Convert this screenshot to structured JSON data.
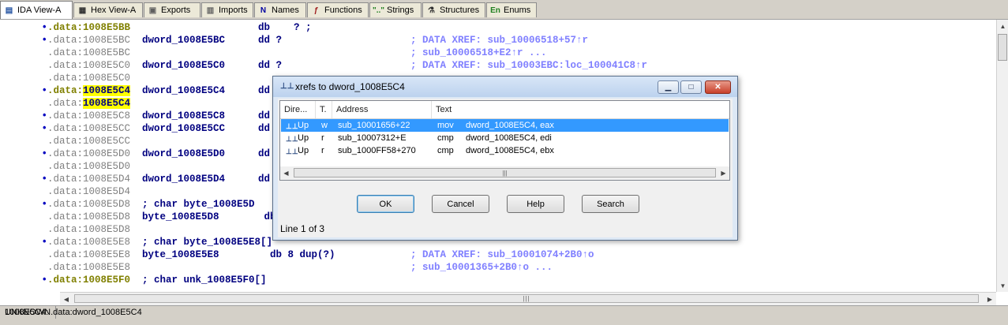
{
  "tabs": [
    {
      "label": "IDA View-A",
      "icon": "ida-view-icon",
      "glyph": "▤",
      "color": "#2050a0",
      "active": true
    },
    {
      "label": "Hex View-A",
      "icon": "hex-view-icon",
      "glyph": "▦",
      "color": "#303030",
      "active": false
    },
    {
      "label": "Exports",
      "icon": "exports-icon",
      "glyph": "▣",
      "color": "#606060",
      "active": false
    },
    {
      "label": "Imports",
      "icon": "imports-icon",
      "glyph": "▥",
      "color": "#606060",
      "active": false
    },
    {
      "label": "Names",
      "icon": "names-icon",
      "glyph": "N",
      "color": "#0000a0",
      "active": false
    },
    {
      "label": "Functions",
      "icon": "functions-icon",
      "glyph": "ƒ",
      "color": "#a02020",
      "active": false
    },
    {
      "label": "Strings",
      "icon": "strings-icon",
      "glyph": "\"..\"",
      "color": "#208020",
      "active": false
    },
    {
      "label": "Structures",
      "icon": "structures-icon",
      "glyph": "⚗",
      "color": "#303030",
      "active": false
    },
    {
      "label": "Enums",
      "icon": "enums-icon",
      "glyph": "En",
      "color": "#208020",
      "active": false
    }
  ],
  "listing": [
    {
      "bullet": "•",
      "addr_prefix": ".data:",
      "addr": "1008E5BB",
      "highlight": false,
      "dim": false,
      "name": "",
      "op": "db    ? ;",
      "comment": ""
    },
    {
      "bullet": "•",
      "addr_prefix": ".data:",
      "addr": "1008E5BC",
      "highlight": false,
      "dim": true,
      "name": "dword_1008E5BC",
      "op": "dd ?",
      "comment": "; DATA XREF: sub_10006518+57↑r"
    },
    {
      "bullet": "",
      "addr_prefix": ".data:",
      "addr": "1008E5BC",
      "highlight": false,
      "dim": true,
      "name": "",
      "op": "",
      "comment": "; sub_10006518+E2↑r ..."
    },
    {
      "bullet": "",
      "addr_prefix": ".data:",
      "addr": "1008E5C0",
      "highlight": false,
      "dim": true,
      "name": "dword_1008E5C0",
      "op": "dd ?",
      "comment": "; DATA XREF: sub_10003EBC:loc_100041C8↑r"
    },
    {
      "bullet": "",
      "addr_prefix": ".data:",
      "addr": "1008E5C0",
      "highlight": false,
      "dim": true,
      "name": "",
      "op": "",
      "comment": ""
    },
    {
      "bullet": "•",
      "addr_prefix": ".data:",
      "addr": "1008E5C4",
      "highlight": true,
      "dim": false,
      "name": "dword_1008E5C4",
      "op": "dd",
      "comment": ""
    },
    {
      "bullet": "",
      "addr_prefix": ".data:",
      "addr": "1008E5C4",
      "highlight": true,
      "dim": true,
      "name": "",
      "op": "",
      "comment": ""
    },
    {
      "bullet": "•",
      "addr_prefix": ".data:",
      "addr": "1008E5C8",
      "highlight": false,
      "dim": true,
      "name": "dword_1008E5C8",
      "op": "dd",
      "comment": ""
    },
    {
      "bullet": "•",
      "addr_prefix": ".data:",
      "addr": "1008E5CC",
      "highlight": false,
      "dim": true,
      "name": "dword_1008E5CC",
      "op": "dd",
      "comment": ""
    },
    {
      "bullet": "",
      "addr_prefix": ".data:",
      "addr": "1008E5CC",
      "highlight": false,
      "dim": true,
      "name": "",
      "op": "",
      "comment": ""
    },
    {
      "bullet": "•",
      "addr_prefix": ".data:",
      "addr": "1008E5D0",
      "highlight": false,
      "dim": true,
      "name": "dword_1008E5D0",
      "op": "dd",
      "comment": ""
    },
    {
      "bullet": "",
      "addr_prefix": ".data:",
      "addr": "1008E5D0",
      "highlight": false,
      "dim": true,
      "name": "",
      "op": "",
      "comment": ""
    },
    {
      "bullet": "•",
      "addr_prefix": ".data:",
      "addr": "1008E5D4",
      "highlight": false,
      "dim": true,
      "name": "dword_1008E5D4",
      "op": "dd",
      "comment": ""
    },
    {
      "bullet": "",
      "addr_prefix": ".data:",
      "addr": "1008E5D4",
      "highlight": false,
      "dim": true,
      "name": "",
      "op": "",
      "comment": ""
    },
    {
      "bullet": "•",
      "addr_prefix": ".data:",
      "addr": "1008E5D8",
      "highlight": false,
      "dim": true,
      "name": "; char byte_1008E5D",
      "op": "",
      "comment": ""
    },
    {
      "bullet": "",
      "addr_prefix": ".data:",
      "addr": "1008E5D8",
      "highlight": false,
      "dim": true,
      "name": "byte_1008E5D8",
      "op": " db",
      "comment": ""
    },
    {
      "bullet": "",
      "addr_prefix": ".data:",
      "addr": "1008E5D8",
      "highlight": false,
      "dim": true,
      "name": "",
      "op": "",
      "comment": ""
    },
    {
      "bullet": "•",
      "addr_prefix": ".data:",
      "addr": "1008E5E8",
      "highlight": false,
      "dim": true,
      "name": "; char byte_1008E5E8[]",
      "op": "",
      "comment": ""
    },
    {
      "bullet": "",
      "addr_prefix": ".data:",
      "addr": "1008E5E8",
      "highlight": false,
      "dim": true,
      "name": "byte_1008E5E8",
      "op": "  db 8 dup(?)",
      "comment": "; DATA XREF: sub_10001074+2B0↑o"
    },
    {
      "bullet": "",
      "addr_prefix": ".data:",
      "addr": "1008E5E8",
      "highlight": false,
      "dim": true,
      "name": "",
      "op": "",
      "comment": "; sub_10001365+2B0↑o ..."
    },
    {
      "bullet": "•",
      "addr_prefix": ".data:",
      "addr": "1008E5F0",
      "highlight": false,
      "dim": false,
      "name": "; char unk_1008E5F0[]",
      "op": "",
      "comment": ""
    }
  ],
  "status": {
    "mode": "UNKNOWN",
    "location": "1008E5C4: .data:dword_1008E5C4"
  },
  "dialog": {
    "title": "xrefs to dword_1008E5C4",
    "columns": [
      "Dire...",
      "T.",
      "Address",
      "Text"
    ],
    "rows": [
      {
        "direction": "Up",
        "type": "w",
        "address": "sub_10001656+22",
        "text_mnem": "mov",
        "text_ops": "dword_1008E5C4, eax",
        "selected": true
      },
      {
        "direction": "Up",
        "type": "r",
        "address": "sub_10007312+E",
        "text_mnem": "cmp",
        "text_ops": "dword_1008E5C4, edi",
        "selected": false
      },
      {
        "direction": "Up",
        "type": "r",
        "address": "sub_1000FF58+270",
        "text_mnem": "cmp",
        "text_ops": "dword_1008E5C4, ebx",
        "selected": false
      }
    ],
    "buttons": {
      "ok": "OK",
      "cancel": "Cancel",
      "help": "Help",
      "search": "Search"
    },
    "status_line": "Line 1 of 3"
  },
  "colors": {
    "selection": "#3399ff",
    "highlight": "#ffff00",
    "comment": "#8080ff",
    "address": "#808000"
  }
}
